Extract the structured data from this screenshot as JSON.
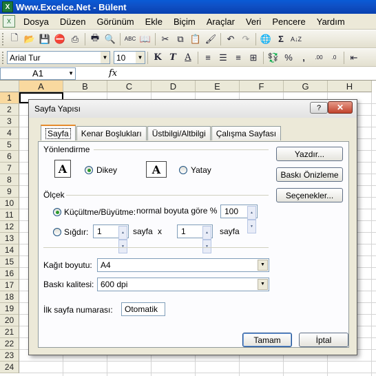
{
  "app": {
    "title": "Www.Excelce.Net - Bülent",
    "icon": "excel-icon"
  },
  "menu": {
    "items": [
      {
        "label": "Dosya",
        "accel": "D"
      },
      {
        "label": "Düzen",
        "accel": "ü"
      },
      {
        "label": "Görünüm",
        "accel": "G"
      },
      {
        "label": "Ekle",
        "accel": "k"
      },
      {
        "label": "Biçim",
        "accel": "B"
      },
      {
        "label": "Araçlar",
        "accel": "A"
      },
      {
        "label": "Veri",
        "accel": "V"
      },
      {
        "label": "Pencere",
        "accel": "P"
      },
      {
        "label": "Yardım",
        "accel": "Y"
      }
    ]
  },
  "toolbar1": {
    "icons": [
      "new-icon",
      "open-icon",
      "save-icon",
      "permission-icon",
      "print-preview-icon",
      "print-icon",
      "preview-icon",
      "spelling-icon",
      "research-icon",
      "cut-icon",
      "copy-icon",
      "paste-icon",
      "format-painter-icon",
      "undo-icon",
      "redo-icon",
      "hyperlink-icon",
      "autosum-icon",
      "sort-ascending-icon"
    ],
    "autosum_glyph": "Σ"
  },
  "toolbar2": {
    "font_name": "Arial Tur",
    "font_size": "10",
    "bold": "K",
    "italic": "T",
    "underline": "A",
    "percent": "%",
    "comma": ","
  },
  "formula_bar": {
    "name_box": "A1",
    "fx": "fx"
  },
  "grid": {
    "columns": [
      "A",
      "B",
      "C",
      "D",
      "E",
      "F",
      "G",
      "H"
    ],
    "rows": [
      "1",
      "2",
      "3",
      "4",
      "5",
      "6",
      "7",
      "8",
      "9",
      "10",
      "11",
      "12",
      "13",
      "14",
      "15",
      "16",
      "17",
      "18",
      "19",
      "20",
      "21",
      "22",
      "23",
      "24"
    ]
  },
  "dialog": {
    "title": "Sayfa Yapısı",
    "help": "?",
    "close": "✕",
    "tabs": [
      "Sayfa",
      "Kenar Boşlukları",
      "Üstbilgi/Altbilgi",
      "Çalışma Sayfası"
    ],
    "active_tab": "Sayfa",
    "orientation": {
      "label": "Yönlendirme",
      "portrait": "Dikey",
      "landscape": "Yatay",
      "selected": "Dikey",
      "glyph": "A"
    },
    "scaling": {
      "label": "Ölçek",
      "adjust_label": "Küçültme/Büyütme:",
      "normal_size_label": "normal boyuta göre %",
      "percent_value": "100",
      "fit_label": "Sığdır:",
      "pages_wide": "1",
      "pages_tall": "1",
      "pages_label": "sayfa",
      "x_label": "x",
      "selected": "adjust"
    },
    "paper_size": {
      "label": "Kağıt boyutu:",
      "value": "A4"
    },
    "print_quality": {
      "label": "Baskı kalitesi:",
      "value": "600 dpi"
    },
    "first_page": {
      "label": "İlk sayfa numarası:",
      "value": "Otomatik"
    },
    "side_buttons": {
      "print": "Yazdır...",
      "preview": "Baskı Önizleme",
      "options": "Seçenekler..."
    },
    "ok": "Tamam",
    "cancel": "İptal"
  }
}
